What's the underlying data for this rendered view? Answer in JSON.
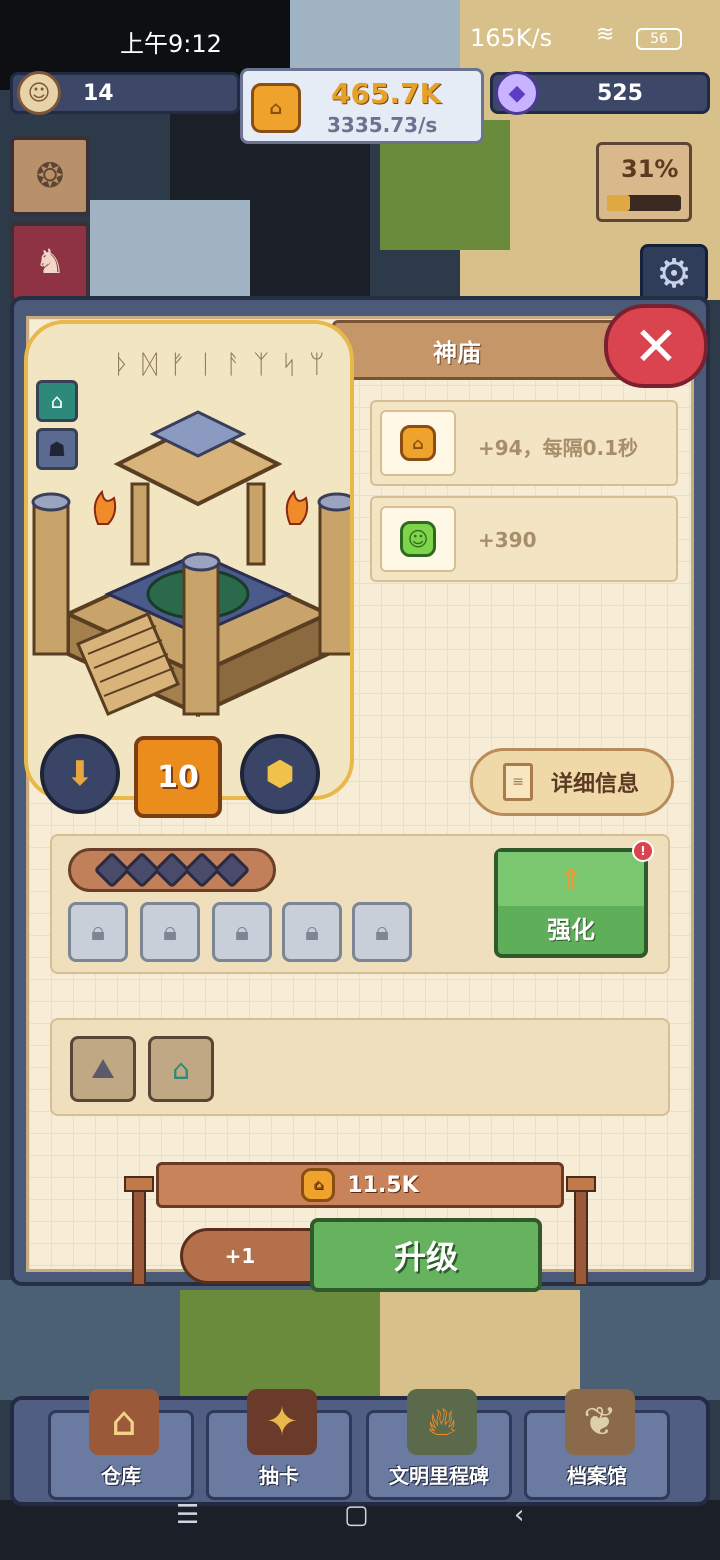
{
  "status_bar": {
    "time": "上午9:12",
    "network_speed": "165K/s",
    "signal_icon": "signal-icon",
    "wifi_icon": "wifi-icon",
    "battery": "56"
  },
  "hud": {
    "population": "14",
    "gold": "465.7K",
    "gold_rate": "3335.73/s",
    "gems": "525",
    "progress_percent": "31%",
    "progress_fraction": 0.31
  },
  "dialog": {
    "title": "神庙",
    "level": "10",
    "runes": "ᚦ ᛞ ᚠ ᛁ ᚨ ᛉ ᛋ ᛘ",
    "production": [
      {
        "icon": "coin-icon",
        "value": "+94，每隔0.1秒"
      },
      {
        "icon": "smile-icon",
        "value": "+390"
      }
    ],
    "detail_label": "详细信息",
    "enhance_label": "强化",
    "enhance_notification": "!",
    "stars_filled": 0,
    "stars_total": 5,
    "locked_slots": 5,
    "upgrade": {
      "cost": "11.5K",
      "plus_label": "+1",
      "button_label": "升级"
    }
  },
  "bottom_nav": [
    {
      "label": "仓库",
      "icon": "warehouse-icon"
    },
    {
      "label": "抽卡",
      "icon": "card-draw-icon"
    },
    {
      "label": "文明里程碑",
      "icon": "milestone-icon"
    },
    {
      "label": "档案馆",
      "icon": "archive-icon"
    }
  ],
  "colors": {
    "gold": "#e5a12a",
    "green_button": "#66b25e",
    "close_red": "#d9444e",
    "panel": "#f7edd6"
  }
}
